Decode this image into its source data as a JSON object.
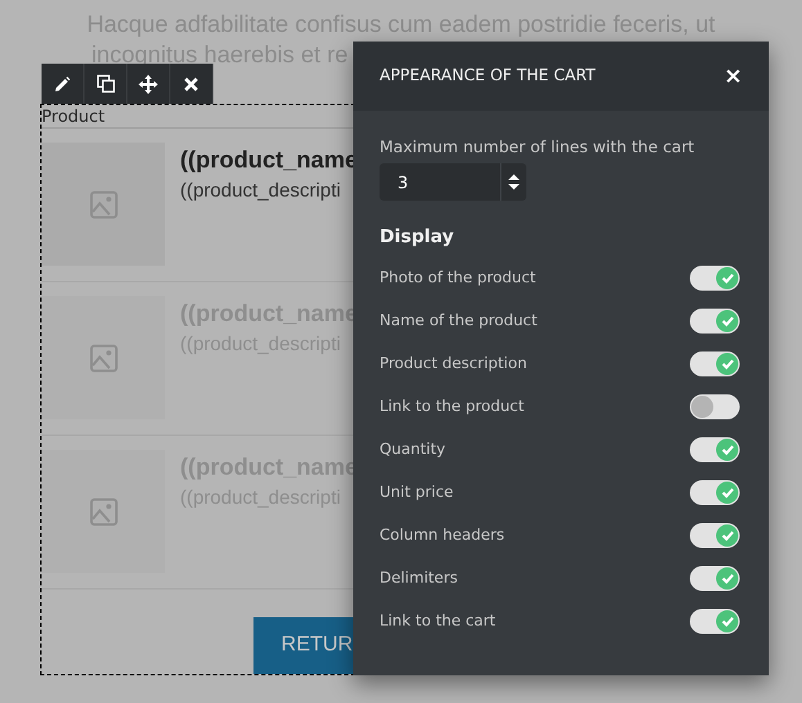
{
  "page": {
    "intro_lines": [
      "Hacque adfabilitate confisus cum eadem postridie feceris, ut",
      "incognitus haerebis et re"
    ]
  },
  "block": {
    "toolbar": [
      {
        "kind": "edit"
      },
      {
        "kind": "duplicate"
      },
      {
        "kind": "move"
      },
      {
        "kind": "delete"
      }
    ],
    "column_header": "Product",
    "rows": [
      {
        "name": "((product_name",
        "description": "((product_descripti",
        "faded": false
      },
      {
        "name": "((product_name",
        "description": "((product_descripti",
        "faded": true
      },
      {
        "name": "((product_name",
        "description": "((product_descripti",
        "faded": true
      }
    ],
    "button": "RETUR"
  },
  "panel": {
    "title": "APPEARANCE OF THE CART",
    "close": "×",
    "max_lines_label": "Maximum number of lines with the cart",
    "max_lines_value": "3",
    "section": "Display",
    "options": [
      {
        "label": "Photo of the product",
        "on": true
      },
      {
        "label": "Name of the product",
        "on": true
      },
      {
        "label": "Product description",
        "on": true
      },
      {
        "label": "Link to the product",
        "on": false
      },
      {
        "label": "Quantity",
        "on": true
      },
      {
        "label": "Unit price",
        "on": true
      },
      {
        "label": "Column headers",
        "on": true
      },
      {
        "label": "Delimiters",
        "on": true
      },
      {
        "label": "Link to the cart",
        "on": true
      }
    ]
  }
}
